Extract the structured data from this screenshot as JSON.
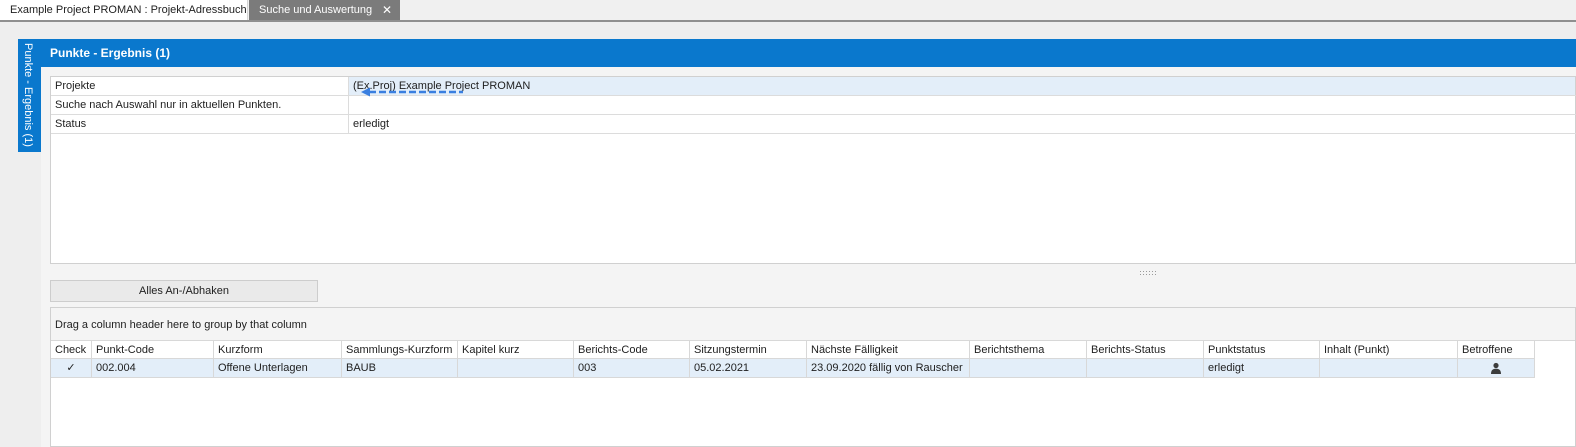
{
  "tabs": [
    {
      "label": "Example Project PROMAN : Projekt-Adressbuch",
      "active": false
    },
    {
      "label": "Suche und Auswertung",
      "active": true,
      "close_glyph": "✕"
    }
  ],
  "dock_tab": {
    "label": "Punkte - Ergebnis (1)"
  },
  "panel": {
    "title": "Punkte - Ergebnis (1)"
  },
  "properties": [
    {
      "name": "Projekte",
      "value": "(Ex.Proj) Example Project PROMAN"
    },
    {
      "name": "Suche nach Auswahl nur in aktuellen Punkten.",
      "value": ""
    },
    {
      "name": "Status",
      "value": "erledigt"
    }
  ],
  "buttons": {
    "check_all": "Alles An-/Abhaken"
  },
  "grid": {
    "group_hint": "Drag a column header here to group by that column",
    "columns": [
      "Check",
      "Punkt-Code",
      "Kurzform",
      "Sammlungs-Kurzform",
      "Kapitel kurz",
      "Berichts-Code",
      "Sitzungstermin",
      "Nächste Fälligkeit",
      "Berichtsthema",
      "Berichts-Status",
      "Punktstatus",
      "Inhalt (Punkt)",
      "Betroffene"
    ],
    "rows": [
      {
        "check": "✓",
        "punkt_code": "002.004",
        "kurzform": "Offene Unterlagen",
        "sammlungs_kurzform": "BAUB",
        "kapitel_kurz": "",
        "berichts_code": "003",
        "sitzungstermin": "05.02.2021",
        "naechste_faelligkeit": "23.09.2020 fällig von Rauscher",
        "berichtsthema": "",
        "berichts_status": "",
        "punktstatus": "erledigt",
        "inhalt": "",
        "betroffene_icon": "person-icon"
      }
    ]
  },
  "colors": {
    "accent": "#0a78cd",
    "selection": "#e3eef9",
    "annotation_arrow": "#3a7fe0"
  }
}
